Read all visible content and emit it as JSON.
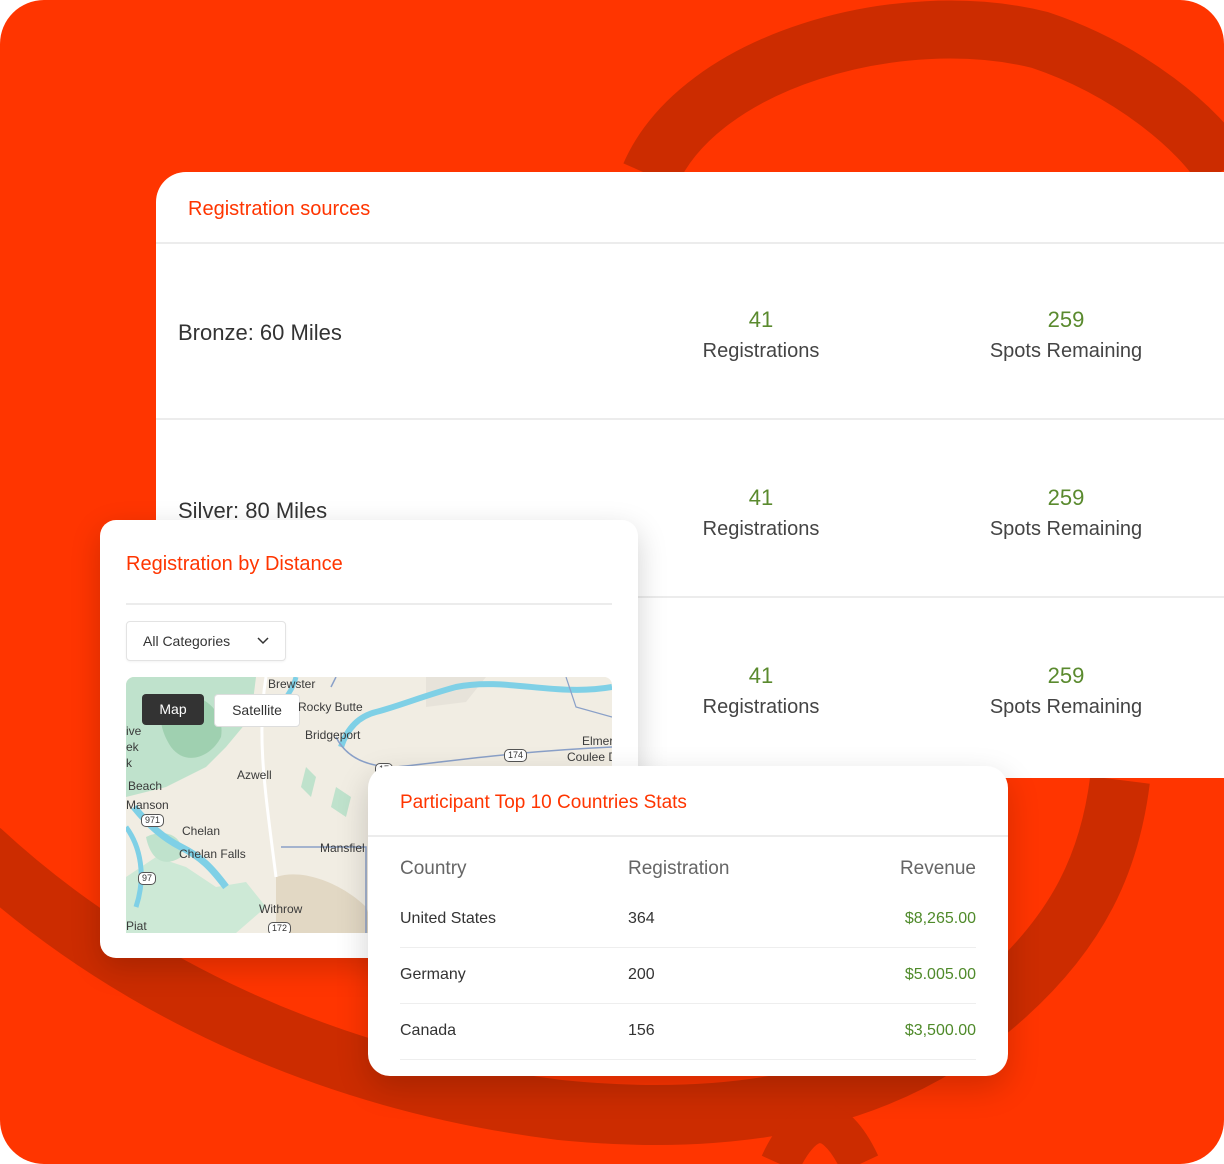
{
  "colors": {
    "accent": "#ff3500",
    "positive": "#5a8a2e",
    "text": "#333333"
  },
  "sources": {
    "title": "Registration sources",
    "rows": [
      {
        "name": "Bronze: 60 Miles",
        "registrations": "41",
        "registrations_label": "Registrations",
        "spots": "259",
        "spots_label": "Spots Remaining"
      },
      {
        "name": "Silver: 80 Miles",
        "registrations": "41",
        "registrations_label": "Registrations",
        "spots": "259",
        "spots_label": "Spots Remaining"
      },
      {
        "name": "",
        "registrations": "41",
        "registrations_label": "Registrations",
        "spots": "259",
        "spots_label": "Spots Remaining"
      }
    ]
  },
  "distance": {
    "title": "Registration by Distance",
    "category_select": "All Categories",
    "chevron_icon": "chevron-down-icon",
    "map": {
      "map_button": "Map",
      "satellite_button": "Satellite",
      "places": [
        "Brewster",
        "Rocky Butte",
        "Bridgeport",
        "Elmer",
        "Coulee D",
        "Azwell",
        "Beach",
        "Manson",
        "Chelan",
        "Chelan Falls",
        "Mansfiel",
        "Withrow",
        "ive",
        "ek",
        "k",
        "Piat"
      ],
      "shields": [
        "174",
        "971",
        "97",
        "172",
        "17"
      ]
    }
  },
  "countries": {
    "title": "Participant Top 10 Countries Stats",
    "columns": [
      "Country",
      "Registration",
      "Revenue"
    ],
    "rows": [
      {
        "country": "United States",
        "registration": "364",
        "revenue": "$8,265.00"
      },
      {
        "country": "Germany",
        "registration": "200",
        "revenue": "$5.005.00"
      },
      {
        "country": "Canada",
        "registration": "156",
        "revenue": "$3,500.00"
      }
    ]
  }
}
